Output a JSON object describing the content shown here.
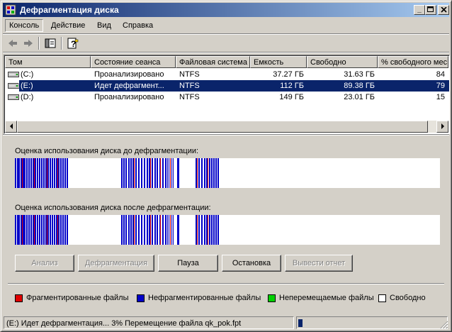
{
  "window": {
    "title": "Дефрагментация диска"
  },
  "menu": [
    {
      "label": "Консоль",
      "active": true
    },
    {
      "label": "Действие",
      "active": false
    },
    {
      "label": "Вид",
      "active": false
    },
    {
      "label": "Справка",
      "active": false
    }
  ],
  "toolbar": {
    "icons": [
      "back-arrow-icon",
      "forward-arrow-icon",
      "show-hide-console-tree-icon",
      "help-icon"
    ]
  },
  "volumes": {
    "columns": [
      "Том",
      "Состояние сеанса",
      "Файловая система",
      "Емкость",
      "Свободно",
      "% свободного мес"
    ],
    "rows": [
      {
        "name": "(C:)",
        "status": "Проанализировано",
        "fs": "NTFS",
        "capacity": "37.27 ГБ",
        "free": "31.63 ГБ",
        "pct": "84",
        "selected": false
      },
      {
        "name": "(E:)",
        "status": "Идет дефрагмент...",
        "fs": "NTFS",
        "capacity": "112 ГБ",
        "free": "89.38 ГБ",
        "pct": "79",
        "selected": true
      },
      {
        "name": "(D:)",
        "status": "Проанализировано",
        "fs": "NTFS",
        "capacity": "149 ГБ",
        "free": "23.01 ГБ",
        "pct": "15",
        "selected": false
      }
    ]
  },
  "analysis": {
    "before_label": "Оценка использования диска до дефрагментации:",
    "after_label": "Оценка использования диска после дефрагментации:"
  },
  "buttons": {
    "analyze": "Анализ",
    "defragment": "Дефрагментация",
    "pause": "Пауза",
    "stop": "Остановка",
    "report": "Вывести отчет"
  },
  "legend": {
    "fragmented": "Фрагментированные файлы",
    "contiguous": "Нефрагментированные файлы",
    "unmovable": "Неперемещаемые файлы",
    "free": "Свободно"
  },
  "colors": {
    "fragmented": "#e00000",
    "contiguous": "#0000c8",
    "unmovable": "#00d000",
    "free": "#ffffff",
    "selection": "#0a246a"
  },
  "statusbar": {
    "text": "(E:) Идет дефрагментация...  3%   Перемещение файла qk_pok.fpt",
    "progress": 0.03
  }
}
